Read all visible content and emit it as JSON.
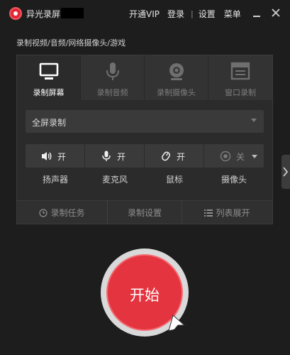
{
  "app": {
    "title": "异光录屏"
  },
  "topnav": {
    "vip": "开通VIP",
    "login": "登录",
    "separator": "|",
    "settings": "设置",
    "menu": "菜单"
  },
  "window_buttons": [
    "minimize-icon",
    "close-icon"
  ],
  "subtitle": "录制视频/音频/网络摄像头/游戏",
  "tabs": [
    {
      "label": "录制屏幕",
      "icon": "monitor-icon",
      "active": true
    },
    {
      "label": "录制音频",
      "icon": "microphone-icon",
      "active": false
    },
    {
      "label": "录制摄像头",
      "icon": "webcam-icon",
      "active": false
    },
    {
      "label": "窗口录制",
      "icon": "window-icon",
      "active": false
    }
  ],
  "mode_select": {
    "value": "全屏录制"
  },
  "toggles": [
    {
      "label": "扬声器",
      "state": "开",
      "icon": "speaker-icon"
    },
    {
      "label": "麦克风",
      "state": "开",
      "icon": "microphone-icon"
    },
    {
      "label": "鼠标",
      "state": "开",
      "icon": "mouse-icon"
    },
    {
      "label": "摄像头",
      "state": "关",
      "icon": "webcam-icon"
    }
  ],
  "bottom_bar": {
    "task": "录制任务",
    "settings": "录制设置",
    "list": "列表展开"
  },
  "start_button": {
    "label": "开始"
  },
  "colors": {
    "accent": "#e3343f",
    "background": "#1d1d1d",
    "panel": "#2b2b2b"
  }
}
